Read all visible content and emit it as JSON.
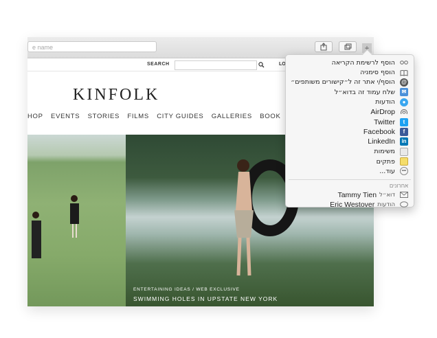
{
  "browser": {
    "url_placeholder": "e name"
  },
  "site": {
    "search_label": "SEARCH",
    "login_label": "LO",
    "logo": "KINFOLK",
    "nav": [
      "HOP",
      "EVENTS",
      "STORIES",
      "FILMS",
      "CITY GUIDES",
      "GALLERIES",
      "BOOK"
    ],
    "feature": {
      "kicker": "ENTERTAINING IDEAS / WEB EXCLUSIVE",
      "headline": "SWIMMING HOLES IN UPSTATE NEW YORK"
    }
  },
  "share_menu": {
    "items": [
      {
        "label": "הוסף לרשימת הקריאה",
        "icon": "reading-list-icon",
        "latin": false
      },
      {
        "label": "הוסף סימניה",
        "icon": "bookmark-icon",
        "latin": false
      },
      {
        "label": "הוסף/י אתר זה ל״קישורים משותפים״",
        "icon": "shared-links-icon",
        "latin": false
      },
      {
        "label": "שלח עמוד זה בדוא״ל",
        "icon": "mail-icon",
        "latin": false
      },
      {
        "label": "הודעות",
        "icon": "messages-icon",
        "latin": false
      },
      {
        "label": "AirDrop",
        "icon": "airdrop-icon",
        "latin": true
      },
      {
        "label": "Twitter",
        "icon": "twitter-icon",
        "latin": true
      },
      {
        "label": "Facebook",
        "icon": "facebook-icon",
        "latin": true
      },
      {
        "label": "LinkedIn",
        "icon": "linkedin-icon",
        "latin": true
      },
      {
        "label": "משימות",
        "icon": "reminders-icon",
        "latin": false
      },
      {
        "label": "פתקים",
        "icon": "notes-icon",
        "latin": false
      },
      {
        "label": "עוד...",
        "icon": "more-icon",
        "latin": false
      }
    ],
    "recents_header": "אחרונים",
    "recents": [
      {
        "name": "Tammy Tien",
        "via": "דוא״ל",
        "icon": "mail-outline-icon"
      },
      {
        "name": "Eric Westover",
        "via": "הודעות",
        "icon": "message-bubble-icon"
      }
    ]
  },
  "colors": {
    "twitter": "#1da1f2",
    "facebook": "#3b5998",
    "linkedin": "#0077b5",
    "messages": "#3aa7f0"
  }
}
